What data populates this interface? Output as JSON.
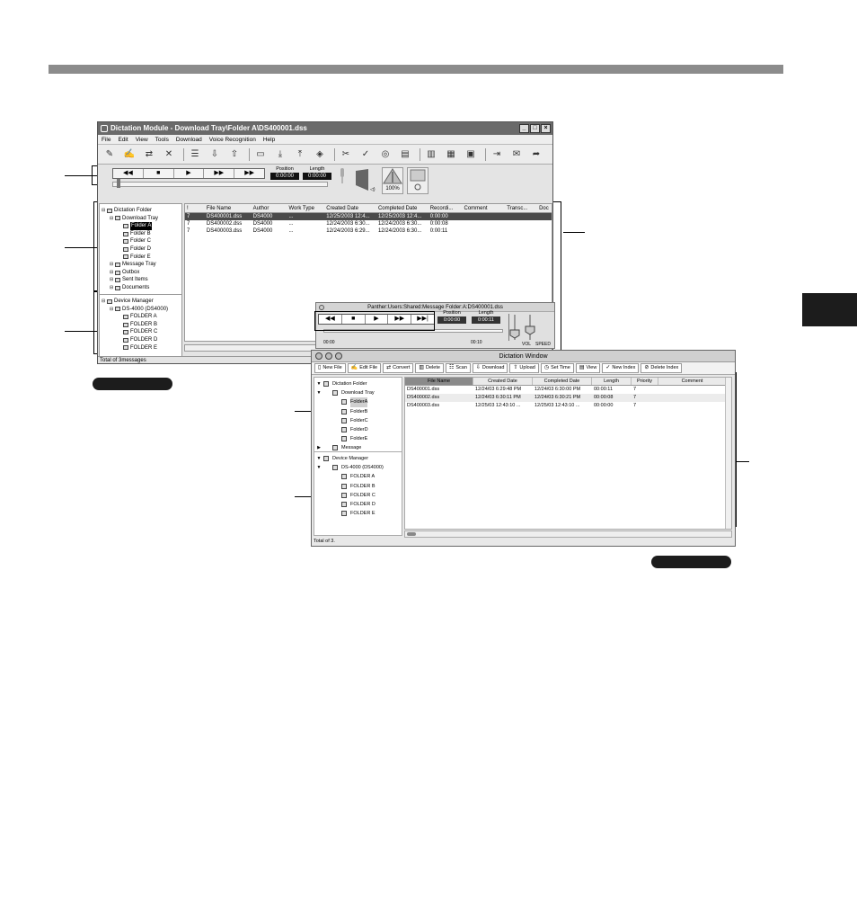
{
  "win": {
    "title": "Dictation Module - Download Tray\\Folder A\\DS400001.dss",
    "menu": [
      "File",
      "Edit",
      "View",
      "Tools",
      "Download",
      "Voice Recognition",
      "Help"
    ],
    "transport": [
      "◀◀",
      "■",
      "▶",
      "▶▶",
      "▶▶"
    ],
    "position_label": "Position",
    "position_value": "0:00:00",
    "length_label": "Length",
    "length_value": "0:00:00",
    "speed_value": "100%",
    "tree_folder": [
      {
        "label": "Dictation Folder",
        "indent": 0
      },
      {
        "label": "Download Tray",
        "indent": 1
      },
      {
        "label": "Folder A",
        "indent": 2,
        "selected": true
      },
      {
        "label": "Folder B",
        "indent": 2
      },
      {
        "label": "Folder C",
        "indent": 2
      },
      {
        "label": "Folder D",
        "indent": 2
      },
      {
        "label": "Folder E",
        "indent": 2
      },
      {
        "label": "Message Tray",
        "indent": 1
      },
      {
        "label": "Outbox",
        "indent": 1
      },
      {
        "label": "Sent Items",
        "indent": 1
      },
      {
        "label": "Documents",
        "indent": 1
      }
    ],
    "tree_device": [
      {
        "label": "Device Manager",
        "indent": 0
      },
      {
        "label": "DS-4000 (DS4000)",
        "indent": 1
      },
      {
        "label": "FOLDER A",
        "indent": 2
      },
      {
        "label": "FOLDER B",
        "indent": 2
      },
      {
        "label": "FOLDER C",
        "indent": 2
      },
      {
        "label": "FOLDER D",
        "indent": 2
      },
      {
        "label": "FOLDER E",
        "indent": 2
      }
    ],
    "columns": [
      "!",
      "File Name",
      "Author",
      "Work Type",
      "Created Date",
      "Completed Date",
      "Recordi...",
      "Comment",
      "Transc...",
      "Doc"
    ],
    "rows": [
      [
        "7",
        "DS400001.dss",
        "DS4000",
        "...",
        "12/25/2003 12:4...",
        "12/25/2003 12:4...",
        "0:00:00",
        "",
        "",
        ""
      ],
      [
        "7",
        "DS400002.dss",
        "DS4000",
        "...",
        "12/24/2003 6:30...",
        "12/24/2003 6:30...",
        "0:00:08",
        "",
        "",
        ""
      ],
      [
        "7",
        "DS400003.dss",
        "DS4000",
        "...",
        "12/24/2003 6:29...",
        "12/24/2003 6:30...",
        "0:00:11",
        "",
        "",
        ""
      ]
    ],
    "status": "Total of 3messages"
  },
  "mplayer": {
    "title": "Panther:Users:Shared:Message Folder:A:DS400001.dss",
    "transport": [
      "◀◀",
      "■",
      "▶",
      "▶▶",
      "▶▶|"
    ],
    "position_label": "Position",
    "position_value": "0:00:00",
    "length_label": "Length",
    "length_value": "0:00:11",
    "time_start": "00:00",
    "time_end": "00:10",
    "vol_label": "VOL",
    "speed_label": "SPEED"
  },
  "mwin": {
    "title": "Dictation Window",
    "toolbar": [
      "New File",
      "Edit File",
      "Convert",
      "Delete",
      "Scan",
      "Download",
      "Upload",
      "Set Time",
      "View",
      "New Index",
      "Delete Index"
    ],
    "tree_folder": [
      {
        "label": "Dictation Folder",
        "indent": 0,
        "tri": "▼"
      },
      {
        "label": "Download Tray",
        "indent": 1,
        "tri": "▼"
      },
      {
        "label": "FolderA",
        "indent": 2,
        "selected": true
      },
      {
        "label": "FolderB",
        "indent": 2
      },
      {
        "label": "FolderC",
        "indent": 2
      },
      {
        "label": "FolderD",
        "indent": 2
      },
      {
        "label": "FolderE",
        "indent": 2
      },
      {
        "label": "Message",
        "indent": 1,
        "tri": "▶"
      }
    ],
    "tree_device": [
      {
        "label": "Device Manager",
        "indent": 0,
        "tri": "▼"
      },
      {
        "label": "DS-4000 (DS4000)",
        "indent": 1,
        "tri": "▼"
      },
      {
        "label": "FOLDER A",
        "indent": 2
      },
      {
        "label": "FOLDER B",
        "indent": 2
      },
      {
        "label": "FOLDER C",
        "indent": 2
      },
      {
        "label": "FOLDER D",
        "indent": 2
      },
      {
        "label": "FOLDER E",
        "indent": 2
      }
    ],
    "columns": [
      "File Name",
      "Created Date",
      "Completed Date",
      "Length",
      "Priority",
      "Comment"
    ],
    "rows": [
      [
        "DS400001.dss",
        "12/24/03  6:29:48 PM",
        "12/24/03  6:30:00 PM",
        "00:00:11",
        "7",
        ""
      ],
      [
        "DS400002.dss",
        "12/24/03  6:30:11 PM",
        "12/24/03  6:30:21 PM",
        "00:00:08",
        "7",
        ""
      ],
      [
        "DS400003.dss",
        "12/25/03  12:43:10 ...",
        "12/25/03  12:43:10 ...",
        "00:00:00",
        "7",
        ""
      ]
    ],
    "status": "Total of 3."
  }
}
